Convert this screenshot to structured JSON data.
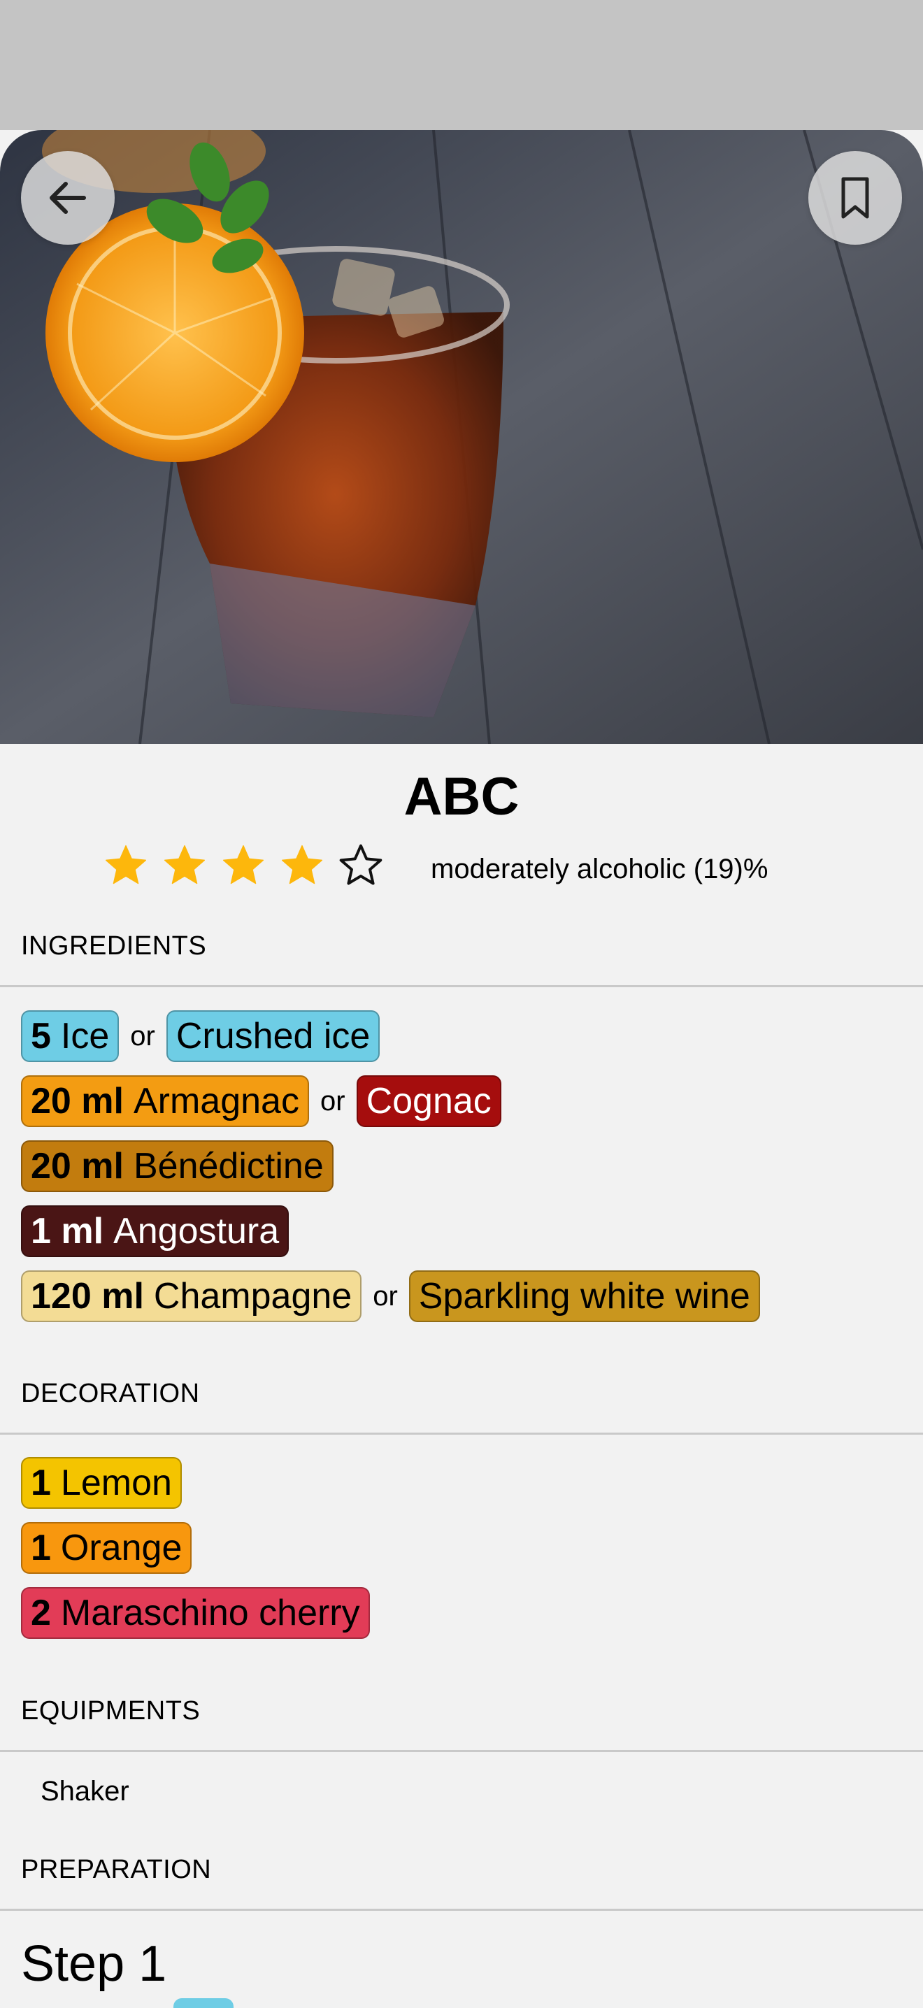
{
  "header": {
    "title": "ABC",
    "rating": 4,
    "rating_max": 5,
    "alcohol": "moderately alcoholic (19)%"
  },
  "hero": {
    "back_icon": "arrow-left-icon",
    "bookmark_icon": "bookmark-icon",
    "image": "cocktail-glass-with-orange-slice-photo"
  },
  "sections": {
    "ingredients": "INGREDIENTS",
    "decoration": "DECORATION",
    "equipments": "EQUIPMENTS",
    "preparation": "PREPARATION"
  },
  "or_label": "or",
  "ingredients": [
    {
      "amount": "5",
      "name": "Ice",
      "color": "#6ecde5",
      "text_color": "#000000",
      "alt": {
        "name": "Crushed ice",
        "color": "#6ecde5",
        "text_color": "#000000"
      }
    },
    {
      "amount": "20 ml",
      "name": "Armagnac",
      "color": "#f39c12",
      "text_color": "#000000",
      "alt": {
        "name": "Cognac",
        "color": "#a50d0d",
        "text_color": "#ffffff"
      }
    },
    {
      "amount": "20 ml",
      "name": "Bénédictine",
      "color": "#c27c0e",
      "text_color": "#000000"
    },
    {
      "amount": "1 ml",
      "name": "Angostura",
      "color": "#4a1515",
      "text_color": "#ffffff"
    },
    {
      "amount": "120 ml",
      "name": "Champagne",
      "color": "#f3dc95",
      "text_color": "#000000",
      "alt": {
        "name": "Sparkling white wine",
        "color": "#c9961e",
        "text_color": "#000000"
      }
    }
  ],
  "decoration": [
    {
      "amount": "1",
      "name": "Lemon",
      "color": "#f4c400",
      "text_color": "#000000"
    },
    {
      "amount": "1",
      "name": "Orange",
      "color": "#f8970e",
      "text_color": "#000000"
    },
    {
      "amount": "2",
      "name": "Maraschino cherry",
      "color": "#e23c57",
      "text_color": "#000000"
    }
  ],
  "equipments": [
    "Shaker"
  ],
  "preparation": {
    "step_label": "Step 1"
  }
}
